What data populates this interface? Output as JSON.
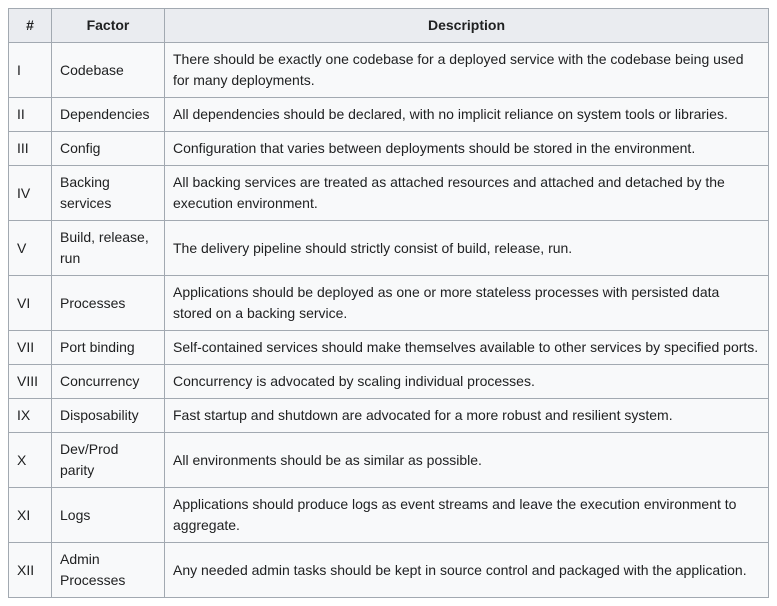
{
  "headers": {
    "num": "#",
    "factor": "Factor",
    "description": "Description"
  },
  "rows": [
    {
      "num": "I",
      "factor": "Codebase",
      "description": "There should be exactly one codebase for a deployed service with the codebase being used for many deployments."
    },
    {
      "num": "II",
      "factor": "Dependencies",
      "description": "All dependencies should be declared, with no implicit reliance on system tools or libraries."
    },
    {
      "num": "III",
      "factor": "Config",
      "description": "Configuration that varies between deployments should be stored in the environment."
    },
    {
      "num": "IV",
      "factor": "Backing services",
      "description": "All backing services are treated as attached resources and attached and detached by the execution environment."
    },
    {
      "num": "V",
      "factor": "Build, release, run",
      "description": "The delivery pipeline should strictly consist of build, release, run."
    },
    {
      "num": "VI",
      "factor": "Processes",
      "description": "Applications should be deployed as one or more stateless processes with persisted data stored on a backing service."
    },
    {
      "num": "VII",
      "factor": "Port binding",
      "description": "Self-contained services should make themselves available to other services by specified ports."
    },
    {
      "num": "VIII",
      "factor": "Concurrency",
      "description": "Concurrency is advocated by scaling individual processes."
    },
    {
      "num": "IX",
      "factor": "Disposability",
      "description": "Fast startup and shutdown are advocated for a more robust and resilient system."
    },
    {
      "num": "X",
      "factor": "Dev/Prod parity",
      "description": "All environments should be as similar as possible."
    },
    {
      "num": "XI",
      "factor": "Logs",
      "description": "Applications should produce logs as event streams and leave the execution environment to aggregate."
    },
    {
      "num": "XII",
      "factor": "Admin Processes",
      "description": "Any needed admin tasks should be kept in source control and packaged with the application."
    }
  ]
}
